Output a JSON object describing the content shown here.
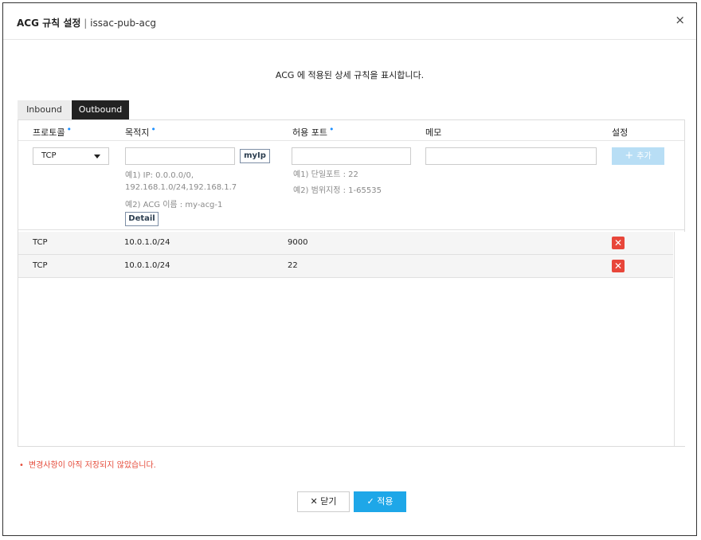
{
  "dialog": {
    "title": "ACG 규칙 설정",
    "separator": "|",
    "subtitle": "issac-pub-acg",
    "close_icon": "×",
    "description": "ACG 에 적용된 상세 규칙을 표시합니다."
  },
  "tabs": [
    {
      "label": "Inbound",
      "active": false
    },
    {
      "label": "Outbound",
      "active": true
    }
  ],
  "columns": {
    "protocol": "프로토콜",
    "destination": "목적지",
    "port": "허용 포트",
    "memo": "메모",
    "settings": "설정"
  },
  "form": {
    "protocol_value": "TCP",
    "destination_value": "",
    "myip_label": "myIp",
    "destination_hint_1a": "예1) IP: 0.0.0.0/0,",
    "destination_hint_1b": "192.168.1.0/24,192.168.1.7",
    "destination_hint_2": "예2) ACG 이름 : my-acg-1",
    "detail_label": "Detail",
    "port_value": "",
    "port_hint_1": "예1) 단일포트 : 22",
    "port_hint_2": "예2) 범위지정 : 1-65535",
    "memo_value": "",
    "add_label": "추가",
    "add_icon": "+"
  },
  "rules": [
    {
      "protocol": "TCP",
      "destination": "10.0.1.0/24",
      "port": "9000"
    },
    {
      "protocol": "TCP",
      "destination": "10.0.1.0/24",
      "port": "22"
    }
  ],
  "delete_icon": "✕",
  "warning": {
    "dot": "•",
    "text": "변경사항이 아직 저장되지 않았습니다."
  },
  "footer": {
    "close_icon": "✕",
    "close_label": "닫기",
    "apply_icon": "✓",
    "apply_label": "적용"
  },
  "colors": {
    "accent": "#1ea7e8",
    "danger": "#e8463a",
    "required_dot": "#1e90ff"
  }
}
